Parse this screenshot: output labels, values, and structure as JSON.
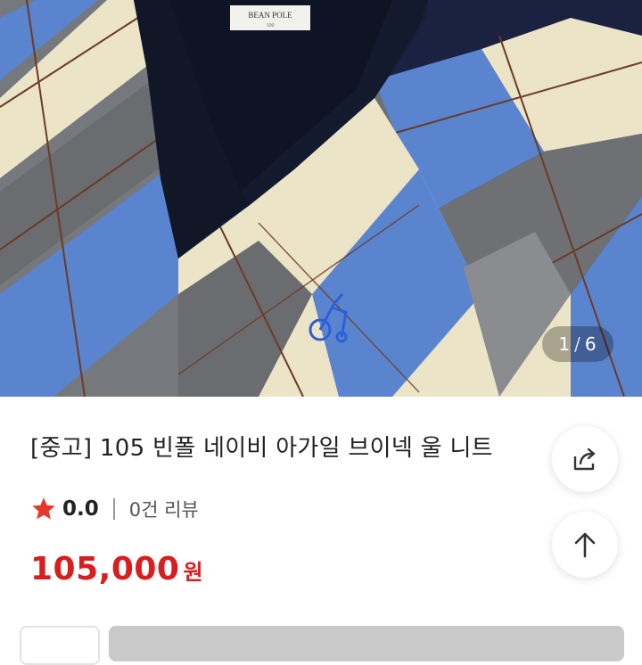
{
  "product": {
    "title": "[중고] 105 빈폴 네이비 아가일 브이넥 울 니트",
    "rating": "0.0",
    "review_count": "0건 리뷰",
    "price": "105,000",
    "currency": "원"
  },
  "gallery": {
    "current": "1",
    "separator": "/",
    "total": "6",
    "brand_label": "BEAN POLE"
  },
  "icons": {
    "share": "share-icon",
    "scroll_top": "arrow-up-icon",
    "rating": "star-icon"
  },
  "colors": {
    "price_red": "#d81e1e",
    "star_red": "#e8372a",
    "navy": "#1b2140",
    "argyle_blue": "#5b84cf",
    "argyle_cream": "#ece4c7",
    "argyle_gray": "#6f7073"
  }
}
